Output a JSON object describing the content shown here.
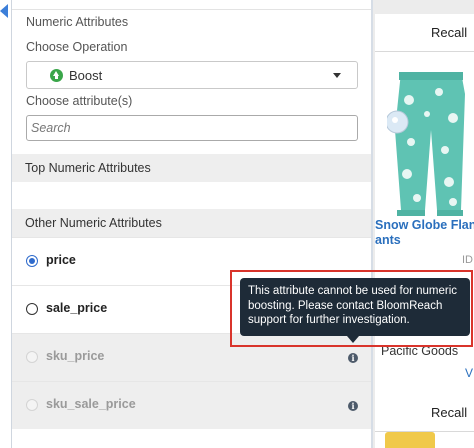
{
  "filter_panel": {
    "numeric_attributes_label": "Numeric Attributes",
    "choose_operation_label": "Choose Operation",
    "operation": {
      "selected": "Boost",
      "icon": "arrow-up-circle-icon",
      "icon_color": "#3aa64a"
    },
    "choose_attribute_label": "Choose attribute(s)",
    "search": {
      "placeholder": "Search",
      "value": ""
    },
    "top_section_header": "Top Numeric Attributes",
    "other_section_header": "Other Numeric Attributes",
    "attributes": [
      {
        "label": "price",
        "selected": true,
        "disabled": false
      },
      {
        "label": "sale_price",
        "selected": false,
        "disabled": false
      },
      {
        "label": "sku_price",
        "selected": false,
        "disabled": true,
        "has_info_icon": true
      },
      {
        "label": "sku_sale_price",
        "selected": false,
        "disabled": true,
        "has_info_icon": true
      }
    ]
  },
  "tooltip": {
    "text": "This attribute cannot be used for numeric boosting. Please contact BloomReach support for further investigation.",
    "highlight_color": "#d9342b"
  },
  "products": [
    {
      "action_label": "Recall",
      "title": "Snow Globe Flan\nants",
      "id_label": "ID",
      "brand": "Pacific Goods",
      "link_text": "V"
    },
    {
      "action_label": "Recall"
    }
  ],
  "colors": {
    "accent_blue": "#2f6bcc",
    "link_blue": "#2a6fbd",
    "tooltip_bg": "#1e2b38",
    "section_bg": "#eeeeee"
  }
}
